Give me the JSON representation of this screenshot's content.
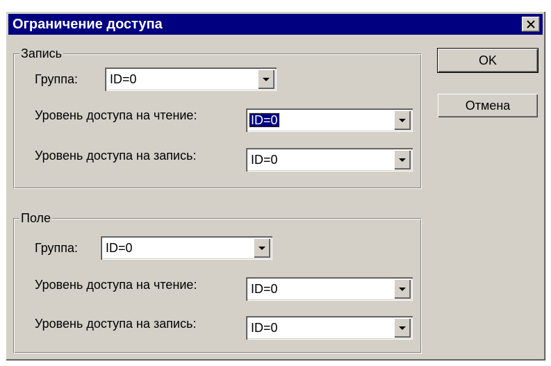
{
  "dialog": {
    "title": "Ограничение доступа",
    "close_icon": "close-icon"
  },
  "record_group": {
    "label": "Запись",
    "group_label": "Группа:",
    "group_value": "ID=0",
    "read_label": "Уровень доступа на чтение:",
    "read_value": "ID=0",
    "write_label": "Уровень доступа на запись:",
    "write_value": "ID=0"
  },
  "field_group": {
    "label": "Поле",
    "group_label": "Группа:",
    "group_value": "ID=0",
    "read_label": "Уровень доступа на чтение:",
    "read_value": "ID=0",
    "write_label": "Уровень доступа на запись:",
    "write_value": "ID=0"
  },
  "buttons": {
    "ok": "OK",
    "cancel": "Отмена"
  },
  "colors": {
    "titlebar": "#000080",
    "face": "#d4d0c8"
  }
}
